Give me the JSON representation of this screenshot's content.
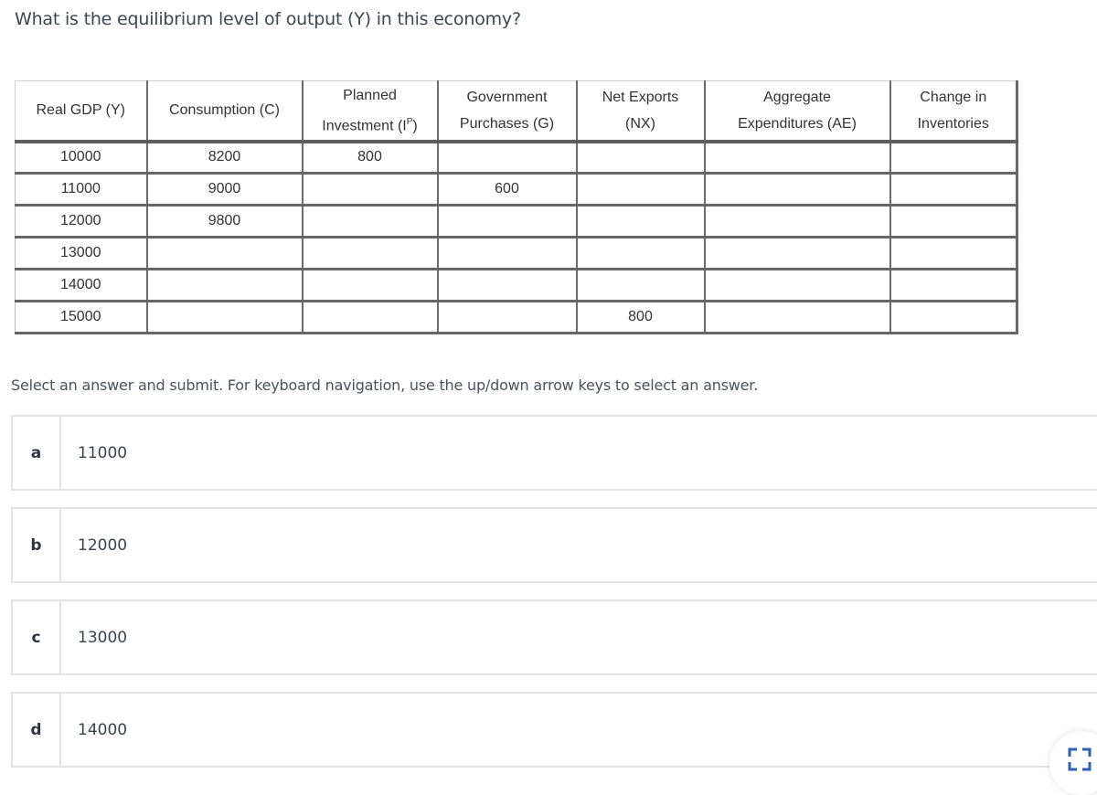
{
  "question": "What is the equilibrium level of output (Y) in this economy?",
  "table": {
    "headers": [
      {
        "line1": "Real GDP (Y)",
        "line2": ""
      },
      {
        "line1": "Consumption (C)",
        "line2": ""
      },
      {
        "line1": "Planned",
        "line2": "Investment (I",
        "sup": "P",
        "suffix": ")"
      },
      {
        "line1": "Government",
        "line2": "Purchases (G)"
      },
      {
        "line1": "Net Exports",
        "line2": "(NX)"
      },
      {
        "line1": "Aggregate",
        "line2": "Expenditures (AE)"
      },
      {
        "line1": "Change in",
        "line2": "Inventories"
      }
    ],
    "rows": [
      [
        "10000",
        "8200",
        "800",
        "",
        "",
        "",
        ""
      ],
      [
        "11000",
        "9000",
        "",
        "600",
        "",
        "",
        ""
      ],
      [
        "12000",
        "9800",
        "",
        "",
        "",
        "",
        ""
      ],
      [
        "13000",
        "",
        "",
        "",
        "",
        "",
        ""
      ],
      [
        "14000",
        "",
        "",
        "",
        "",
        "",
        ""
      ],
      [
        "15000",
        "",
        "",
        "",
        "800",
        "",
        ""
      ]
    ]
  },
  "instructions": "Select an answer and submit. For keyboard navigation, use the up/down arrow keys to select an answer.",
  "options": [
    {
      "letter": "a",
      "value": "11000"
    },
    {
      "letter": "b",
      "value": "12000"
    },
    {
      "letter": "c",
      "value": "13000"
    },
    {
      "letter": "d",
      "value": "14000"
    }
  ],
  "fullscreen_icon": "expand-icon",
  "accent_color": "#2f5fb3"
}
